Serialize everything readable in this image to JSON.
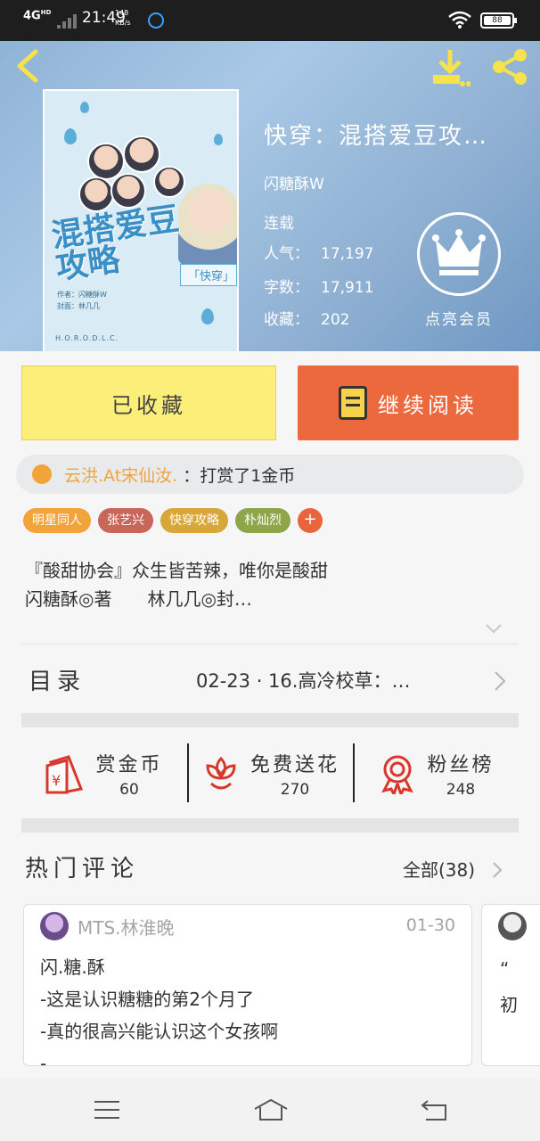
{
  "status_bar": {
    "network": "4G",
    "network_sub": "HD",
    "time": "21:49",
    "speed_value": "148",
    "speed_unit": "KB/s",
    "battery": "88"
  },
  "header": {
    "back_icon": "chevron-left-icon",
    "download_icon": "download-icon",
    "share_icon": "share-icon"
  },
  "book": {
    "title": "快穿：混搭爱豆攻…",
    "author": "闪糖酥W",
    "status": "连载",
    "stats": [
      {
        "label": "人气：",
        "value": "17,197"
      },
      {
        "label": "字数：",
        "value": "17,911"
      },
      {
        "label": "收藏：",
        "value": "202"
      }
    ],
    "vip_label": "点亮会员",
    "cover": {
      "title_line1": "混搭爱豆",
      "title_line2": "攻略",
      "genre_tag": "「快穿」",
      "credit_author": "作者：闪糖酥W",
      "credit_cover": "封面：林几几",
      "footer": "H.O.R.O.D.L.C."
    }
  },
  "actions": {
    "collected_label": "已收藏",
    "continue_label": "继续阅读"
  },
  "reward": {
    "user": "云洪.At宋仙汝.",
    "message": "：打赏了1金币"
  },
  "tags": [
    {
      "label": "明星同人",
      "color": "#f2a33a"
    },
    {
      "label": "张艺兴",
      "color": "#c9665a"
    },
    {
      "label": "快穿攻略",
      "color": "#d8a73a"
    },
    {
      "label": "朴灿烈",
      "color": "#8ea54a"
    }
  ],
  "tag_add": "+",
  "intro": {
    "line1": "『酸甜协会』众生皆苦辣，唯你是酸甜",
    "line2": "闪糖酥◎著　　林几几◎封…"
  },
  "toc": {
    "label": "目录",
    "latest": "02-23 · 16.高冷校草：…"
  },
  "quick_actions": [
    {
      "name": "reward-coins",
      "label": "赏金币",
      "count": "60"
    },
    {
      "name": "free-flowers",
      "label": "免费送花",
      "count": "270"
    },
    {
      "name": "fan-ranking",
      "label": "粉丝榜",
      "count": "248"
    }
  ],
  "comments": {
    "title": "热门评论",
    "all_label": "全部(38)",
    "items": [
      {
        "user": "MTS.林淮晚",
        "date": "01-30",
        "text": "闪.糖.酥\n-这是认识糖糖的第2个月了\n-真的很高兴能认识这个女孩啊\n-…"
      },
      {
        "user": "",
        "date": "",
        "text": "“\n初"
      }
    ]
  }
}
